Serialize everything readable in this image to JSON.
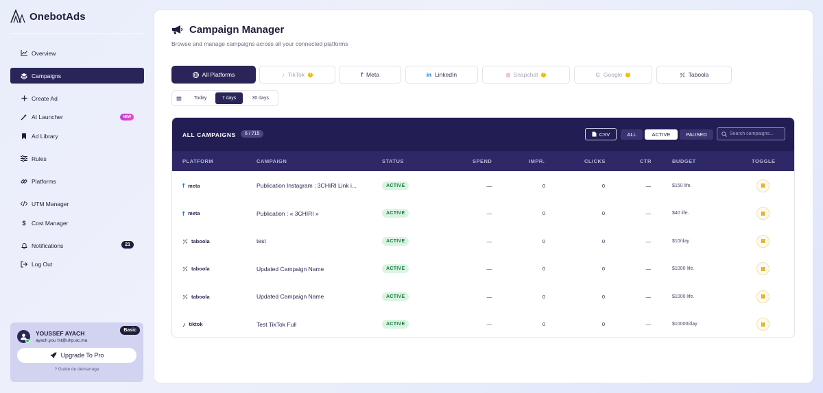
{
  "app": {
    "name": "OnebotAds"
  },
  "sidebar": {
    "items": [
      {
        "label": "Overview",
        "icon": "chart-icon"
      },
      {
        "label": "Campaigns",
        "icon": "layers-icon",
        "active": true
      },
      {
        "label": "Create Ad",
        "icon": "plus-icon"
      },
      {
        "label": "AI Launcher",
        "icon": "wand-icon",
        "badge": "NEW"
      },
      {
        "label": "Ad Library",
        "icon": "bookmark-icon"
      },
      {
        "label": "Rules",
        "icon": "sliders-icon"
      },
      {
        "label": "Platforms",
        "icon": "link-icon"
      },
      {
        "label": "UTM Manager",
        "icon": "code-icon"
      },
      {
        "label": "Cost Manager",
        "icon": "dollar-icon"
      },
      {
        "label": "Notifications",
        "icon": "bell-icon",
        "count": "21"
      },
      {
        "label": "Log Out",
        "icon": "logout-icon"
      }
    ]
  },
  "user": {
    "name": "YOUSSEF AYACH",
    "email": "ayach.you fst@uhp.ac.ma",
    "plan": "Basic",
    "upgrade_label": "Upgrade To Pro",
    "guide_label": "? Guide de démarrage"
  },
  "header": {
    "title": "Campaign Manager",
    "subtitle": "Browse and manage campaigns across all your connected platforms"
  },
  "platform_tabs": [
    {
      "label": "All Platforms",
      "icon": "globe-icon",
      "active": true
    },
    {
      "label": "TikTok",
      "icon": "tiktok-icon",
      "warning": true,
      "dim": true
    },
    {
      "label": "Meta",
      "icon": "meta-icon"
    },
    {
      "label": "LinkedIn",
      "icon": "linkedin-icon"
    },
    {
      "label": "Snapchat",
      "icon": "snapchat-icon",
      "warning": true,
      "dim": true
    },
    {
      "label": "Google",
      "icon": "google-icon",
      "warning": true,
      "dim": true
    },
    {
      "label": "Taboola",
      "icon": "taboola-icon"
    }
  ],
  "date_range": {
    "options": [
      "Today",
      "7 days",
      "30 days"
    ],
    "selected": "7 days"
  },
  "table": {
    "title": "ALL CAMPAIGNS",
    "count": "6 / 715",
    "csv_label": "CSV",
    "filters": [
      "ALL",
      "ACTIVE",
      "PAUSED"
    ],
    "selected_filter": "ACTIVE",
    "search_placeholder": "Search campaigns...",
    "columns": [
      "PLATFORM",
      "CAMPAIGN",
      "STATUS",
      "SPEND",
      "IMPR.",
      "CLICKS",
      "CTR",
      "BUDGET",
      "TOGGLE"
    ],
    "rows": [
      {
        "platform": "meta",
        "campaign": "Publication Instagram : 3CHIRI Link i...",
        "status": "ACTIVE",
        "spend": "—",
        "impr": "0",
        "clicks": "0",
        "ctr": "—",
        "budget": "$150 life."
      },
      {
        "platform": "meta",
        "campaign": "Publication : « 3CHIRI »",
        "status": "ACTIVE",
        "spend": "—",
        "impr": "0",
        "clicks": "0",
        "ctr": "—",
        "budget": "$40 life."
      },
      {
        "platform": "taboola",
        "campaign": "test",
        "status": "ACTIVE",
        "spend": "—",
        "impr": "0",
        "clicks": "0",
        "ctr": "—",
        "budget": "$10/day"
      },
      {
        "platform": "taboola",
        "campaign": "Updated Campaign Name",
        "status": "ACTIVE",
        "spend": "—",
        "impr": "0",
        "clicks": "0",
        "ctr": "—",
        "budget": "$1000 life."
      },
      {
        "platform": "taboola",
        "campaign": "Updated Campaign Name",
        "status": "ACTIVE",
        "spend": "—",
        "impr": "0",
        "clicks": "0",
        "ctr": "—",
        "budget": "$1000 life."
      },
      {
        "platform": "tiktok",
        "campaign": "Test TikTok Full",
        "status": "ACTIVE",
        "spend": "—",
        "impr": "0",
        "clicks": "0",
        "ctr": "—",
        "budget": "$10000/day"
      }
    ]
  },
  "colors": {
    "brand_dark": "#2a2559",
    "table_head": "#221d53",
    "active_green": "#15803d",
    "warning": "#f5b800"
  }
}
